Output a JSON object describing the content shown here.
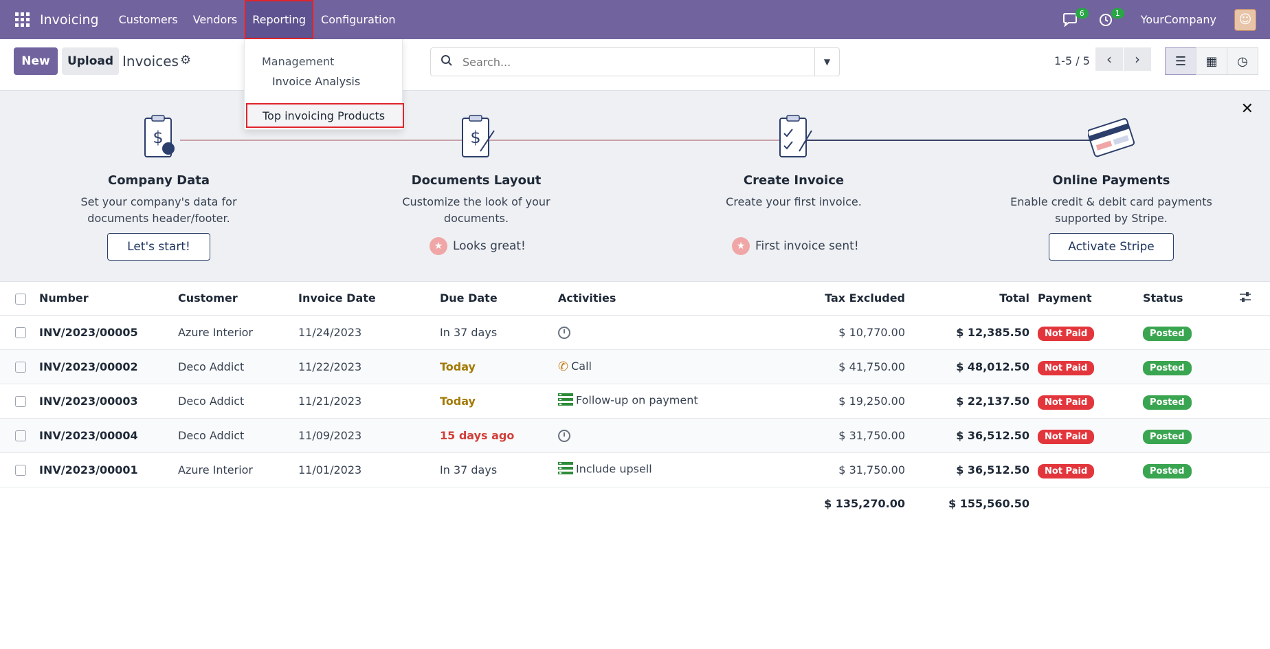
{
  "topbar": {
    "app_name": "Invoicing",
    "menu": [
      "Customers",
      "Vendors",
      "Reporting",
      "Configuration"
    ],
    "chat_count": "6",
    "activity_count": "1",
    "company": "YourCompany",
    "bg_color": "#71639e"
  },
  "control": {
    "new_label": "New",
    "upload_label": "Upload",
    "breadcrumb": "Invoices",
    "search_placeholder": "Search...",
    "pager": "1-5 / 5"
  },
  "dropdown": {
    "header": "Management",
    "item1": "Invoice Analysis",
    "item2": "Top invoicing Products"
  },
  "onboarding": {
    "steps": [
      {
        "title": "Company Data",
        "desc": "Set your company's data for documents header/footer.",
        "action": "Let's start!"
      },
      {
        "title": "Documents Layout",
        "desc": "Customize the look of your documents.",
        "done": "Looks great!"
      },
      {
        "title": "Create Invoice",
        "desc": "Create your first invoice.",
        "done": "First invoice sent!"
      },
      {
        "title": "Online Payments",
        "desc": "Enable credit & debit card payments supported by Stripe.",
        "action": "Activate Stripe"
      }
    ]
  },
  "table": {
    "headers": [
      "Number",
      "Customer",
      "Invoice Date",
      "Due Date",
      "Activities",
      "Tax Excluded",
      "Total",
      "Payment",
      "Status"
    ],
    "rows": [
      {
        "number": "INV/2023/00005",
        "customer": "Azure Interior",
        "date": "11/24/2023",
        "due": "In 37 days",
        "due_style": "normal",
        "activity": "",
        "activity_icon": "clock-icon",
        "tax": "$ 10,770.00",
        "total": "$ 12,385.50",
        "payment": "Not Paid",
        "status": "Posted"
      },
      {
        "number": "INV/2023/00002",
        "customer": "Deco Addict",
        "date": "11/22/2023",
        "due": "Today",
        "due_style": "today",
        "activity": "Call",
        "activity_icon": "phone-icon",
        "tax": "$ 41,750.00",
        "total": "$ 48,012.50",
        "payment": "Not Paid",
        "status": "Posted"
      },
      {
        "number": "INV/2023/00003",
        "customer": "Deco Addict",
        "date": "11/21/2023",
        "due": "Today",
        "due_style": "today",
        "activity": "Follow-up on payment",
        "activity_icon": "tasks-icon",
        "tax": "$ 19,250.00",
        "total": "$ 22,137.50",
        "payment": "Not Paid",
        "status": "Posted"
      },
      {
        "number": "INV/2023/00004",
        "customer": "Deco Addict",
        "date": "11/09/2023",
        "due": "15 days ago",
        "due_style": "overdue",
        "activity": "",
        "activity_icon": "clock-icon",
        "tax": "$ 31,750.00",
        "total": "$ 36,512.50",
        "payment": "Not Paid",
        "status": "Posted"
      },
      {
        "number": "INV/2023/00001",
        "customer": "Azure Interior",
        "date": "11/01/2023",
        "due": "In 37 days",
        "due_style": "normal",
        "activity": "Include upsell",
        "activity_icon": "tasks-icon",
        "tax": "$ 31,750.00",
        "total": "$ 36,512.50",
        "payment": "Not Paid",
        "status": "Posted"
      }
    ],
    "total_tax": "$ 135,270.00",
    "total_total": "$ 155,560.50"
  }
}
